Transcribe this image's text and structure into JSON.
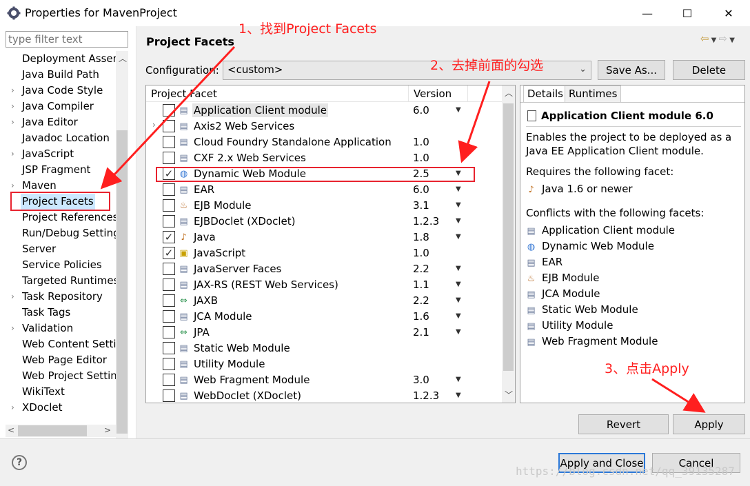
{
  "window": {
    "title": "Properties for MavenProject",
    "minimize_glyph": "—",
    "maximize_glyph": "☐",
    "close_glyph": "✕"
  },
  "sidebar": {
    "filter_placeholder": "type filter text",
    "items": [
      {
        "label": "Deployment Assen",
        "has_children": false
      },
      {
        "label": "Java Build Path",
        "has_children": false
      },
      {
        "label": "Java Code Style",
        "has_children": true
      },
      {
        "label": "Java Compiler",
        "has_children": true
      },
      {
        "label": "Java Editor",
        "has_children": true
      },
      {
        "label": "Javadoc Location",
        "has_children": false
      },
      {
        "label": "JavaScript",
        "has_children": true
      },
      {
        "label": "JSP Fragment",
        "has_children": false
      },
      {
        "label": "Maven",
        "has_children": true
      },
      {
        "label": "Project Facets",
        "has_children": false
      },
      {
        "label": "Project References",
        "has_children": false
      },
      {
        "label": "Run/Debug Settings",
        "has_children": false
      },
      {
        "label": "Server",
        "has_children": false
      },
      {
        "label": "Service Policies",
        "has_children": false
      },
      {
        "label": "Targeted Runtimes",
        "has_children": false
      },
      {
        "label": "Task Repository",
        "has_children": true
      },
      {
        "label": "Task Tags",
        "has_children": false
      },
      {
        "label": "Validation",
        "has_children": true
      },
      {
        "label": "Web Content Setti",
        "has_children": false
      },
      {
        "label": "Web Page Editor",
        "has_children": false
      },
      {
        "label": "Web Project Settin",
        "has_children": false
      },
      {
        "label": "WikiText",
        "has_children": false
      },
      {
        "label": "XDoclet",
        "has_children": true
      }
    ],
    "selected_index": 9
  },
  "main": {
    "title": "Project Facets",
    "configuration_label": "Configuration:",
    "configuration_value": "<custom>",
    "save_as_label": "Save As...",
    "delete_label": "Delete",
    "columns": {
      "facet": "Project Facet",
      "version": "Version"
    },
    "facets": [
      {
        "name": "Application Client module",
        "version": "6.0",
        "checked": false,
        "dropdown": true,
        "icon": "page",
        "highlight": true
      },
      {
        "name": "Axis2 Web Services",
        "version": "",
        "checked": false,
        "dropdown": false,
        "icon": "page",
        "expand": true
      },
      {
        "name": "Cloud Foundry Standalone Application",
        "version": "1.0",
        "checked": false,
        "dropdown": false,
        "icon": "page"
      },
      {
        "name": "CXF 2.x Web Services",
        "version": "1.0",
        "checked": false,
        "dropdown": false,
        "icon": "page"
      },
      {
        "name": "Dynamic Web Module",
        "version": "2.5",
        "checked": true,
        "dropdown": true,
        "icon": "globe"
      },
      {
        "name": "EAR",
        "version": "6.0",
        "checked": false,
        "dropdown": true,
        "icon": "page"
      },
      {
        "name": "EJB Module",
        "version": "3.1",
        "checked": false,
        "dropdown": true,
        "icon": "bean"
      },
      {
        "name": "EJBDoclet (XDoclet)",
        "version": "1.2.3",
        "checked": false,
        "dropdown": true,
        "icon": "page"
      },
      {
        "name": "Java",
        "version": "1.8",
        "checked": true,
        "dropdown": true,
        "icon": "java"
      },
      {
        "name": "JavaScript",
        "version": "1.0",
        "checked": true,
        "dropdown": false,
        "icon": "lock"
      },
      {
        "name": "JavaServer Faces",
        "version": "2.2",
        "checked": false,
        "dropdown": true,
        "icon": "page"
      },
      {
        "name": "JAX-RS (REST Web Services)",
        "version": "1.1",
        "checked": false,
        "dropdown": true,
        "icon": "page"
      },
      {
        "name": "JAXB",
        "version": "2.2",
        "checked": false,
        "dropdown": true,
        "icon": "arrows"
      },
      {
        "name": "JCA Module",
        "version": "1.6",
        "checked": false,
        "dropdown": true,
        "icon": "page"
      },
      {
        "name": "JPA",
        "version": "2.1",
        "checked": false,
        "dropdown": true,
        "icon": "arrows"
      },
      {
        "name": "Static Web Module",
        "version": "",
        "checked": false,
        "dropdown": false,
        "icon": "page"
      },
      {
        "name": "Utility Module",
        "version": "",
        "checked": false,
        "dropdown": false,
        "icon": "page"
      },
      {
        "name": "Web Fragment Module",
        "version": "3.0",
        "checked": false,
        "dropdown": true,
        "icon": "page"
      },
      {
        "name": "WebDoclet (XDoclet)",
        "version": "1.2.3",
        "checked": false,
        "dropdown": true,
        "icon": "page"
      }
    ],
    "details": {
      "tab_details": "Details",
      "tab_runtimes": "Runtimes",
      "heading": "Application Client module 6.0",
      "description": "Enables the project to be deployed as a Java EE Application Client module.",
      "requires_label": "Requires the following facet:",
      "requires": [
        "Java 1.6 or newer"
      ],
      "conflicts_label": "Conflicts with the following facets:",
      "conflicts": [
        {
          "name": "Application Client module",
          "icon": "page"
        },
        {
          "name": "Dynamic Web Module",
          "icon": "globe"
        },
        {
          "name": "EAR",
          "icon": "page"
        },
        {
          "name": "EJB Module",
          "icon": "bean"
        },
        {
          "name": "JCA Module",
          "icon": "page"
        },
        {
          "name": "Static Web Module",
          "icon": "page"
        },
        {
          "name": "Utility Module",
          "icon": "page"
        },
        {
          "name": "Web Fragment Module",
          "icon": "page"
        }
      ]
    },
    "revert_label": "Revert",
    "apply_label": "Apply"
  },
  "footer": {
    "apply_close_label": "Apply and Close",
    "cancel_label": "Cancel"
  },
  "annotations": {
    "step1": "1、找到Project Facets",
    "step2": "2、去掉前面的勾选",
    "step3": "3、点击Apply",
    "color": "#ff1f1f"
  },
  "watermark": "https://blog.csdn.net/qq_39135287"
}
